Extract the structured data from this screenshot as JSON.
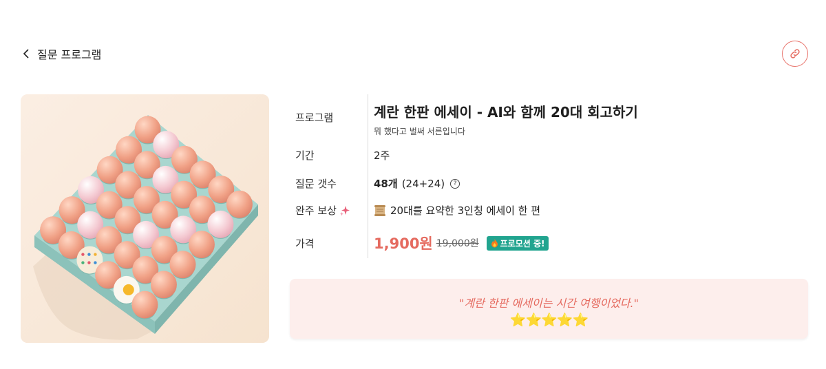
{
  "nav": {
    "back_label": "질문 프로그램"
  },
  "icons": {
    "back": "chevron-left-icon",
    "share": "link-icon",
    "sparkle": "sparkle-icon",
    "scroll": "scroll-icon",
    "fire": "fire-icon",
    "help": "question-circle-icon"
  },
  "colors": {
    "accent": "#e56a5f",
    "promo": "#21a48f",
    "review_bg": "#fdeeec"
  },
  "details": {
    "program_label": "프로그램",
    "title": "계란 한판 에세이 - AI와 함께 20대 회고하기",
    "subtitle": "뭐 했다고 벌써 서른입니다",
    "period_label": "기간",
    "period_value": "2주",
    "count_label": "질문 갯수",
    "count_value": "48개",
    "count_detail": "(24+24)",
    "help_glyph": "?",
    "reward_label": "완주 보상",
    "reward_value": "20대를 요약한 3인칭 에세이 한 편",
    "price_label": "가격",
    "price_now": "1,900원",
    "price_old": "19,000원",
    "promo_label": "프로모션 중!"
  },
  "review": {
    "quote": "\"계란 한판 에세이는 시간 여행이었다.\"",
    "stars": "⭐⭐⭐⭐⭐",
    "rating": 5
  }
}
